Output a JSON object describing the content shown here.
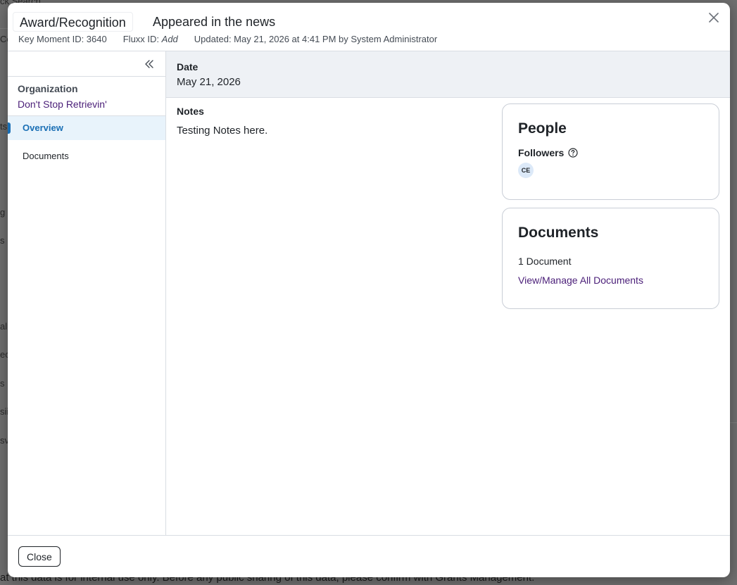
{
  "background": {
    "fragments": [
      "ck Search",
      "Co",
      "ts",
      "g",
      "s",
      "al",
      "ec",
      "s",
      "sii",
      "sv"
    ],
    "footer_text": "at this data is for internal use only. Before any public sharing of this data, please confirm with Grants Management."
  },
  "modal": {
    "type_label": "Award/Recognition",
    "title": "Appeared in the news",
    "meta": {
      "key_moment": "Key Moment ID: 3640",
      "fluxx_prefix": "Fluxx ID:",
      "fluxx_value": "Add",
      "updated": "Updated: May 21, 2026 at 4:41 PM by System Administrator"
    },
    "sidebar": {
      "org_label": "Organization",
      "org_name": "Don't Stop Retrievin'",
      "items": [
        {
          "label": "Overview",
          "active": true
        },
        {
          "label": "Documents",
          "active": false
        }
      ]
    },
    "main": {
      "date_label": "Date",
      "date_value": "May 21, 2026",
      "notes_label": "Notes",
      "notes_value": "Testing Notes here."
    },
    "people_card": {
      "title": "People",
      "followers_label": "Followers",
      "avatar_initials": "CE"
    },
    "documents_card": {
      "title": "Documents",
      "count": "1 Document",
      "link": "View/Manage All Documents"
    },
    "footer": {
      "close_label": "Close"
    }
  },
  "icons": {
    "close": "close-x-icon",
    "collapse": "double-chevron-left-icon",
    "help": "question-circle-icon"
  },
  "colors": {
    "accent": "#1a6fb5",
    "link": "#4a1e78",
    "active_bg": "#e8f3fb",
    "band_bg": "#eef1f5"
  }
}
